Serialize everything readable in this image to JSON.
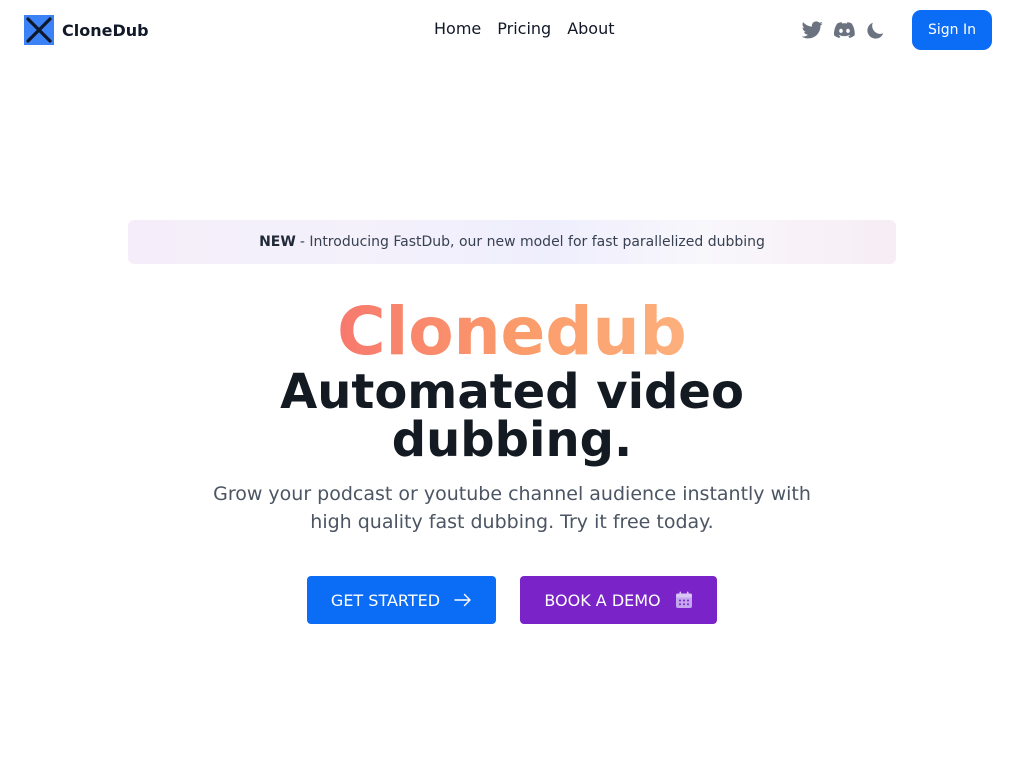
{
  "brand": {
    "name": "CloneDub",
    "logo_icon": "x-logo-icon",
    "logo_colors": {
      "background": "#3b82f6",
      "mark": "#0f172a"
    }
  },
  "nav": {
    "items": [
      {
        "label": "Home"
      },
      {
        "label": "Pricing"
      },
      {
        "label": "About"
      }
    ]
  },
  "social": {
    "icons": [
      "twitter-icon",
      "discord-icon",
      "moon-icon"
    ],
    "icon_color": "#6b7280"
  },
  "header": {
    "signin_label": "Sign In"
  },
  "announcement": {
    "tag": "NEW",
    "text": "- Introducing FastDub, our new model for fast parallelized dubbing"
  },
  "hero": {
    "brand_title": "Clonedub",
    "headline": "Automated video dubbing.",
    "subtitle": "Grow your podcast or youtube channel audience instantly with high quality fast dubbing. Try it free today."
  },
  "cta": {
    "primary_label": "GET STARTED",
    "primary_icon": "arrow-right-icon",
    "secondary_label": "BOOK A DEMO",
    "secondary_icon": "calendar-icon"
  },
  "colors": {
    "primary": "#0b6cf5",
    "secondary": "#7a23c8",
    "brand_gradient_start": "#f8796e",
    "brand_gradient_end": "#fcb07d"
  }
}
